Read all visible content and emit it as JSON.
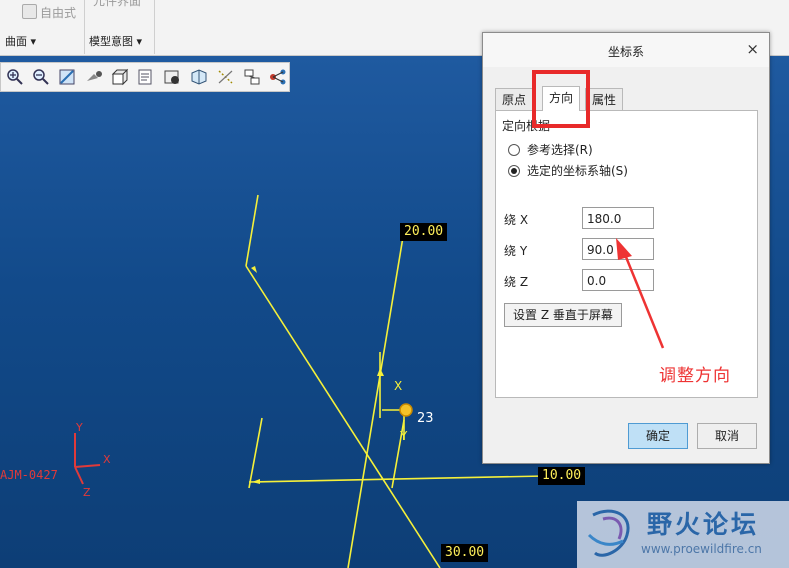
{
  "ribbon": {
    "freestyle_label": "自由式",
    "top_partial": "元件界面",
    "group_surface": "曲面",
    "group_model_intent": "模型意图"
  },
  "toolbar_icons": [
    "zoom-in-icon",
    "zoom-out-icon",
    "refit-icon",
    "repaint-icon",
    "display-style-icon",
    "saved-views-icon",
    "view-manager-icon",
    "perspective-icon",
    "datum-display-icon",
    "annotation-display-icon",
    "spin-center-icon"
  ],
  "dialog": {
    "title": "坐标系",
    "close": "×",
    "tabs": [
      "原点",
      "方向",
      "属性"
    ],
    "active_tab": "方向",
    "orient_group_label": "定向根据",
    "radio_reference": "参考选择(R)",
    "radio_selected_axes": "选定的坐标系轴(S)",
    "selected_radio": "选定的坐标系轴(S)",
    "about_x_label": "绕 X",
    "about_x_value": "180.0",
    "about_y_label": "绕 Y",
    "about_y_value": "90.0",
    "about_z_label": "绕 Z",
    "about_z_value": "0.0",
    "set_z_button": "设置 Z 垂直于屏幕",
    "ok_button": "确定",
    "cancel_button": "取消"
  },
  "annotation": {
    "text": "调整方向",
    "color": "#e33333"
  },
  "dimensions": {
    "d1": "20.00",
    "d2": "10.00",
    "d3": "30.00"
  },
  "csys": {
    "name": "AJM-0427",
    "x": "X",
    "y": "Y",
    "z": "Z",
    "new_x": "X",
    "new_y": "Y",
    "new_tag": "23"
  },
  "watermark": {
    "title": "野火论坛",
    "url": "www.proewildfire.cn"
  },
  "colors": {
    "viewport": "#124a8a",
    "geometry": "#f5f03a",
    "csys": "#e03a3a",
    "accent": "#e82a2a"
  }
}
